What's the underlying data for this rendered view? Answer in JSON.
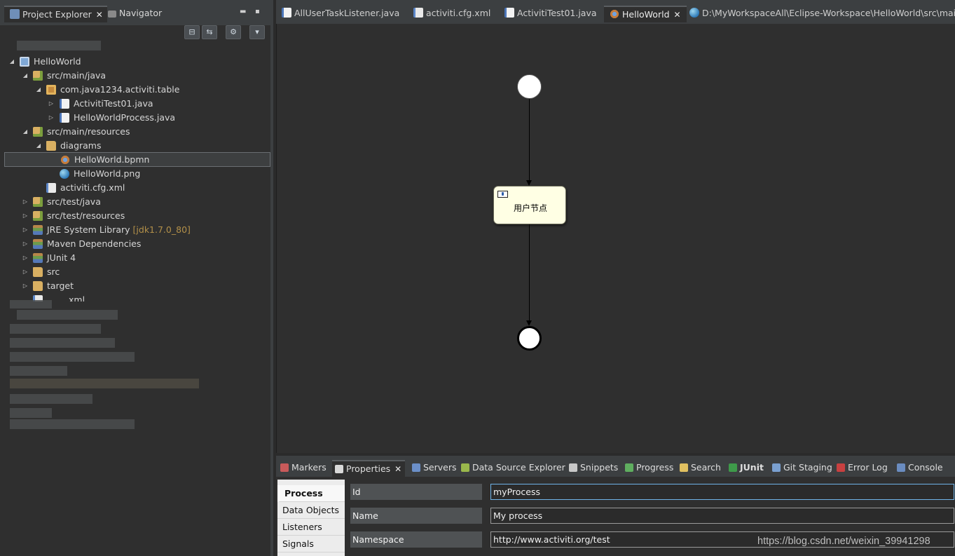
{
  "left_panel": {
    "tabs": [
      {
        "label": "Project Explorer",
        "close": "✕"
      },
      {
        "label": "Navigator"
      }
    ],
    "minimize": "▬",
    "maximize": "▪",
    "toolbar": {
      "collapse": "⊟",
      "link": "⇆",
      "filter": "⚙",
      "menu": "▾"
    },
    "tree": {
      "items": [
        {
          "label": "HelloWorld",
          "twisty": "◢",
          "icon": "project-icon"
        },
        {
          "label": "src/main/java",
          "twisty": "◢",
          "icon": "source-folder-icon"
        },
        {
          "label": "com.java1234.activiti.table",
          "twisty": "◢",
          "icon": "package-icon"
        },
        {
          "label": "ActivitiTest01.java",
          "twisty": "▷",
          "icon": "java-file-icon"
        },
        {
          "label": "HelloWorldProcess.java",
          "twisty": "▷",
          "icon": "java-file-icon"
        },
        {
          "label": "src/main/resources",
          "twisty": "◢",
          "icon": "source-folder-icon"
        },
        {
          "label": "diagrams",
          "twisty": "◢",
          "icon": "folder-icon"
        },
        {
          "label": "HelloWorld.bpmn",
          "twisty": "",
          "icon": "bpmn-file-icon"
        },
        {
          "label": "HelloWorld.png",
          "twisty": "",
          "icon": "png-file-icon"
        },
        {
          "label": "activiti.cfg.xml",
          "twisty": "",
          "icon": "xml-file-icon"
        },
        {
          "label": "src/test/java",
          "twisty": "▷",
          "icon": "source-folder-icon"
        },
        {
          "label": "src/test/resources",
          "twisty": "▷",
          "icon": "source-folder-icon"
        },
        {
          "label": "JRE System Library",
          "decoration": "[jdk1.7.0_80]",
          "twisty": "▷",
          "icon": "library-icon"
        },
        {
          "label": "Maven Dependencies",
          "twisty": "▷",
          "icon": "library-icon"
        },
        {
          "label": "JUnit 4",
          "twisty": "▷",
          "icon": "library-icon"
        },
        {
          "label": "src",
          "twisty": "▷",
          "icon": "folder-icon"
        },
        {
          "label": "target",
          "twisty": "▷",
          "icon": "folder-icon"
        },
        {
          "label": "xml",
          "twisty": "",
          "icon": "xml-file-icon"
        }
      ]
    }
  },
  "editor": {
    "tabs": [
      {
        "label": "AllUserTaskListener.java",
        "icon": "java-file-icon"
      },
      {
        "label": "activiti.cfg.xml",
        "icon": "xml-file-icon"
      },
      {
        "label": "ActivitiTest01.java",
        "icon": "java-file-icon"
      },
      {
        "label": "HelloWorld",
        "icon": "bpmn-file-icon",
        "close": "✕"
      },
      {
        "label": "D:\\MyWorkspaceAll\\Eclipse-Workspace\\HelloWorld\\src\\main\\",
        "icon": "globe-icon"
      }
    ],
    "diagram": {
      "user_task_label": "用户节点"
    }
  },
  "bottom": {
    "tabs": [
      {
        "label": "Markers"
      },
      {
        "label": "Properties",
        "close": "✕"
      },
      {
        "label": "Servers"
      },
      {
        "label": "Data Source Explorer"
      },
      {
        "label": "Snippets"
      },
      {
        "label": "Progress"
      },
      {
        "label": "Search"
      },
      {
        "label": "JUnit"
      },
      {
        "label": "Git Staging"
      },
      {
        "label": "Error Log"
      },
      {
        "label": "Console"
      }
    ],
    "properties": {
      "nav": [
        "Process",
        "Data Objects",
        "Listeners",
        "Signals"
      ],
      "fields": [
        {
          "label": "Id",
          "value": "myProcess"
        },
        {
          "label": "Name",
          "value": "My process"
        },
        {
          "label": "Namespace",
          "value": "http://www.activiti.org/test"
        }
      ]
    }
  },
  "watermark": "https://blog.csdn.net/weixin_39941298",
  "colors": {
    "task_fill": "#ffffe4",
    "canvas": "#2f2f2f",
    "panel": "#3c3f41"
  }
}
